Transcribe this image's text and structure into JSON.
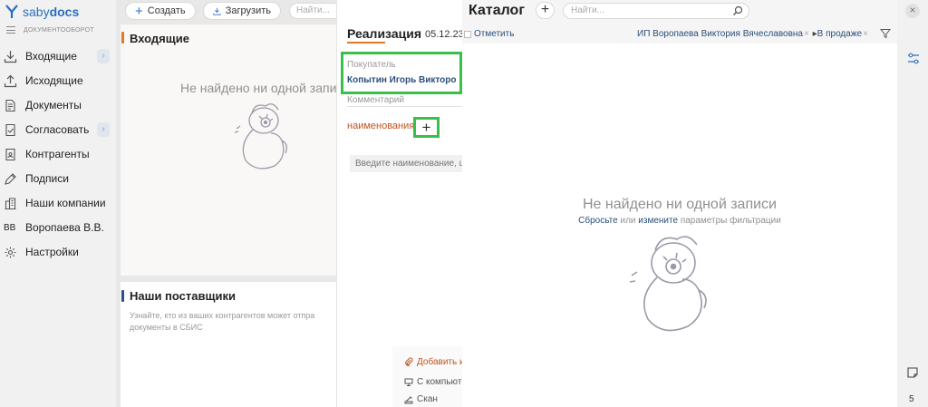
{
  "brand": {
    "name_light": "saby",
    "name_bold": "docs",
    "subtitle": "ДОКУМЕНТООБОРОТ"
  },
  "sidebar": {
    "items": [
      {
        "label": "Входящие",
        "icon": "inbox-icon",
        "chevron": "›"
      },
      {
        "label": "Исходящие",
        "icon": "outbox-icon"
      },
      {
        "label": "Документы",
        "icon": "documents-icon"
      },
      {
        "label": "Согласовать",
        "icon": "approve-icon",
        "chevron": "›"
      },
      {
        "label": "Контрагенты",
        "icon": "contractors-icon"
      },
      {
        "label": "Подписи",
        "icon": "signature-icon"
      },
      {
        "label": "Наши компании",
        "icon": "companies-icon"
      },
      {
        "label": "Воропаева В.В.",
        "initials": "ВВ"
      },
      {
        "label": "Настройки",
        "icon": "settings-icon"
      }
    ]
  },
  "toolbar": {
    "create_label": "Создать",
    "upload_label": "Загрузить",
    "search_placeholder": "Найти..."
  },
  "incoming": {
    "title": "Входящие",
    "empty_text": "Не найдено ни одной запи"
  },
  "suppliers": {
    "title": "Наши поставщики",
    "description": "Узнайте, кто из ваших контрагентов может отпра документы в СБИС"
  },
  "document": {
    "title": "Реализация",
    "date": "05.12.23",
    "buyer_label": "Покупатель",
    "buyer_value": "Копытин Игорь Викторо",
    "comment_placeholder": "Комментарий",
    "names_label": "наименования",
    "add_symbol": "+",
    "name_input_placeholder": "Введите наименование, ш",
    "attach_label": "Добавить и",
    "from_computer_label": "С компьют",
    "scan_label": "Скан"
  },
  "catalog": {
    "title": "Каталог",
    "add_symbol": "+",
    "search_placeholder": "Найти...",
    "mark_label": "Отметить",
    "filter_org": "ИП Воропаева Виктория Вячеславовна",
    "filter_status": "В продаже",
    "empty_title": "Не найдено ни одной записи",
    "hint_reset": "Сбросьте",
    "hint_or": "или",
    "hint_change": "измените",
    "hint_rest": "параметры фильтрации"
  },
  "right_strip": {
    "close_symbol": "×",
    "counter": "5"
  },
  "colors": {
    "accent_orange": "#e07a28",
    "link_blue": "#2a4f7a",
    "highlight_green": "#3ac04a",
    "brand_blue": "#2a6fc0"
  }
}
